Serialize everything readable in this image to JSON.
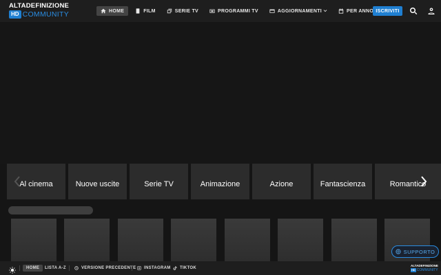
{
  "logo": {
    "top": "ALTADEFINIZIONE",
    "hd": "HD",
    "community": "COMMUNITY"
  },
  "nav": {
    "home": "HOME",
    "film": "FILM",
    "serie_tv": "SERIE TV",
    "programmi_tv": "PROGRAMMI TV",
    "aggiornamenti": "AGGIORNAMENTI",
    "per_anno": "PER ANNO"
  },
  "header": {
    "iscriviti": "ISCRIVITI",
    "search_icon": "search-icon",
    "user_icon": "user-icon"
  },
  "categories": [
    "Al cinema",
    "Nuove uscite",
    "Serie TV",
    "Animazione",
    "Azione",
    "Fantascienza",
    "Romantico"
  ],
  "supporto": {
    "label": "SUPPORTO",
    "icon": "globe-icon"
  },
  "footer": {
    "home": "HOME",
    "lista": "LISTA A-Z",
    "versione": "VERSIONE PRECEDENTE",
    "instagram": "INSTAGRAM",
    "tiktok": "TIKTOK",
    "logo_top": "ALTADEFINIZIONE",
    "logo_hd": "HD",
    "logo_community": "COMMUNITY"
  },
  "colors": {
    "accent": "#1f7fd1",
    "background": "#151515",
    "header": "#1e1e1e",
    "card": "#2c2c2c"
  }
}
